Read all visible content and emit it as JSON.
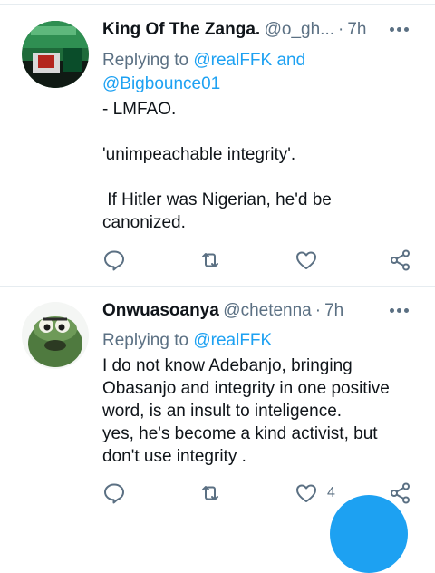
{
  "tweets": [
    {
      "author_name": "King Of The Zanga.",
      "handle": "@o_gh...",
      "separator": "·",
      "time": "7h",
      "replying_prefix": "Replying to",
      "mention_1": "@realFFK",
      "mention_join": "and",
      "mention_2": "@Bigbounce01",
      "body": [
        "- LMFAO.",
        "",
        "'unimpeachable integrity'.",
        "",
        " If Hitler was Nigerian, he'd be canonized."
      ],
      "like_count": ""
    },
    {
      "author_name": "Onwuasoanya",
      "handle": "@chetenna",
      "separator": "·",
      "time": "7h",
      "replying_prefix": "Replying to",
      "mention_1": "@realFFK",
      "body": [
        "I do not know Adebanjo, bringing Obasanjo and integrity in one positive word, is an insult to inteligence.",
        "yes, he's become a kind activist, but don't use integrity ."
      ],
      "like_count": "4"
    }
  ],
  "icons": {
    "reply": "reply-icon",
    "retweet": "retweet-icon",
    "like": "heart-icon",
    "share": "share-icon",
    "more": "more-icon"
  },
  "colors": {
    "accent": "#1da1f2",
    "secondary_text": "#5b7083",
    "primary_text": "#0f1419"
  }
}
